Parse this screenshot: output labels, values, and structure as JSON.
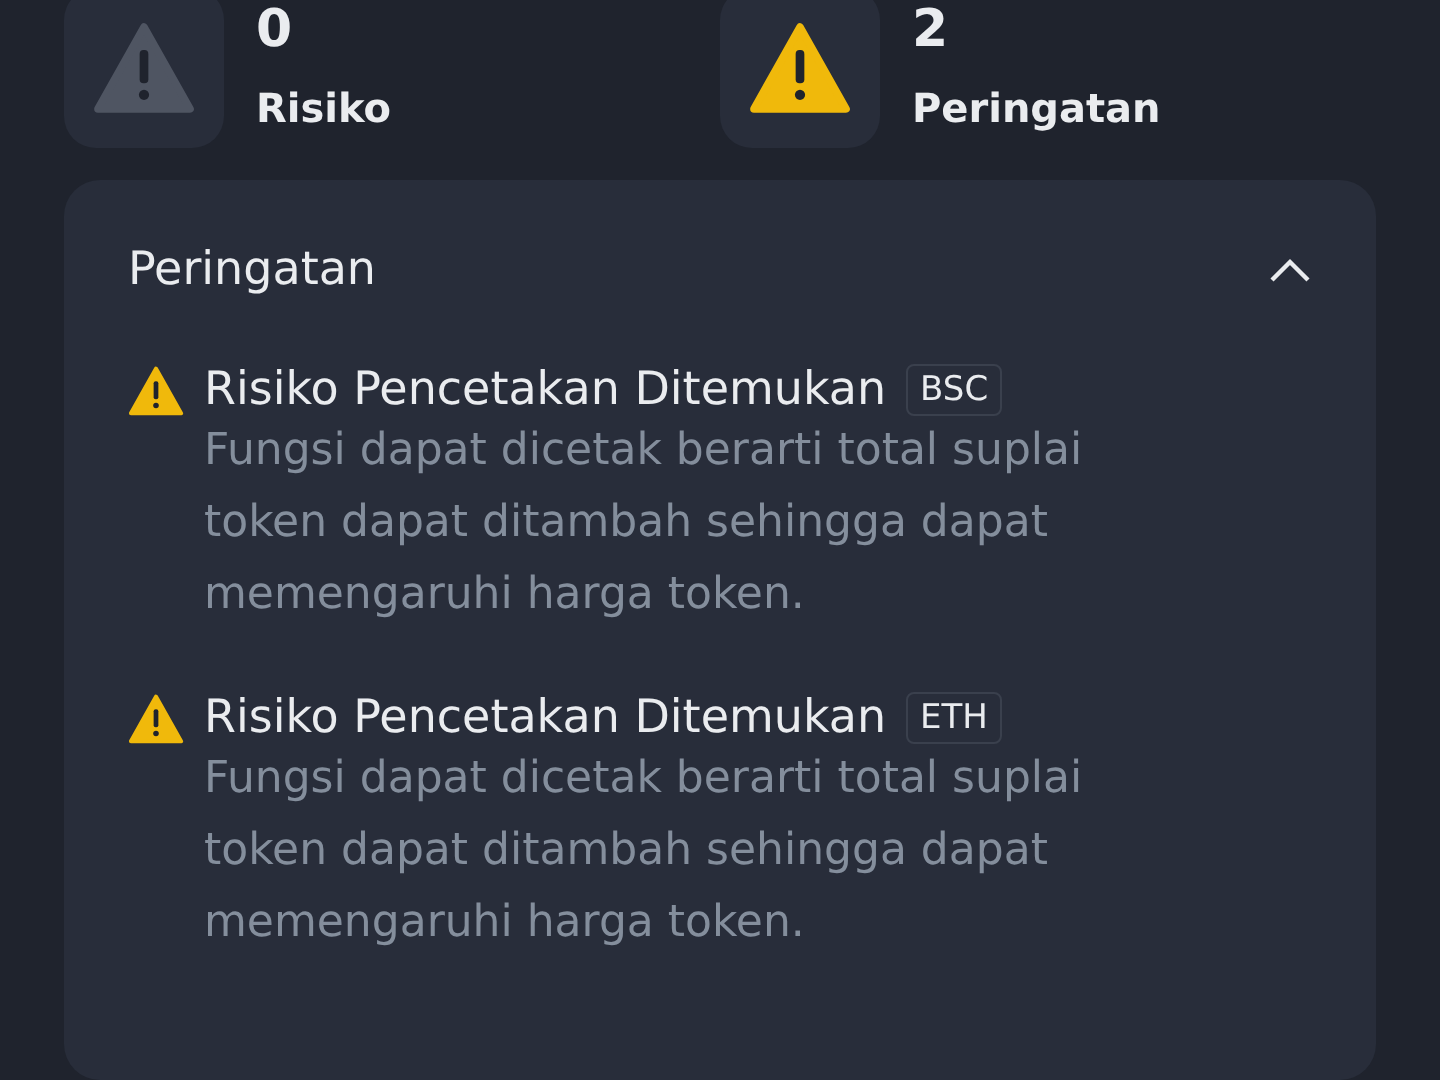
{
  "stats": [
    {
      "value": "0",
      "label": "Risiko",
      "color": "#4f5562"
    },
    {
      "value": "2",
      "label": "Peringatan",
      "color": "#f0b90b"
    }
  ],
  "panel": {
    "title": "Peringatan",
    "expanded": true,
    "warnings": [
      {
        "title": "Risiko Pencetakan Ditemukan",
        "chain": "BSC",
        "description": "Fungsi dapat dicetak berarti total suplai token dapat ditambah sehingga dapat memengaruhi harga token."
      },
      {
        "title": "Risiko Pencetakan Ditemukan",
        "chain": "ETH",
        "description": "Fungsi dapat dicetak berarti total suplai token dapat ditambah sehingga dapat memengaruhi harga token."
      }
    ]
  }
}
